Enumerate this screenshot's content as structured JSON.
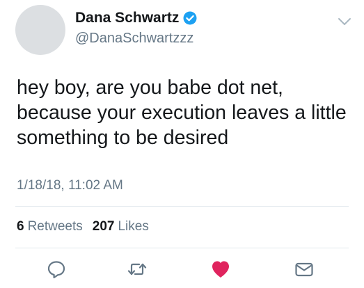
{
  "author": {
    "display_name": "Dana Schwartz",
    "handle": "@DanaSchwartzzz",
    "verified": true
  },
  "tweet": {
    "lines": [
      "hey boy, are you babe dot net,",
      "because your execution leaves a little",
      "something to be desired"
    ],
    "timestamp": "1/18/18, 11:02 AM"
  },
  "stats": {
    "retweets_count": "6",
    "retweets_label": "Retweets",
    "likes_count": "207",
    "likes_label": "Likes"
  },
  "actions": [
    "reply-icon",
    "retweet-icon",
    "heart-icon",
    "envelope-icon"
  ],
  "colors": {
    "text": "#14171a",
    "secondary": "#657786",
    "verified_blue": "#1da1f2",
    "like_red": "#e0245e",
    "divider": "#e1e8ed"
  }
}
